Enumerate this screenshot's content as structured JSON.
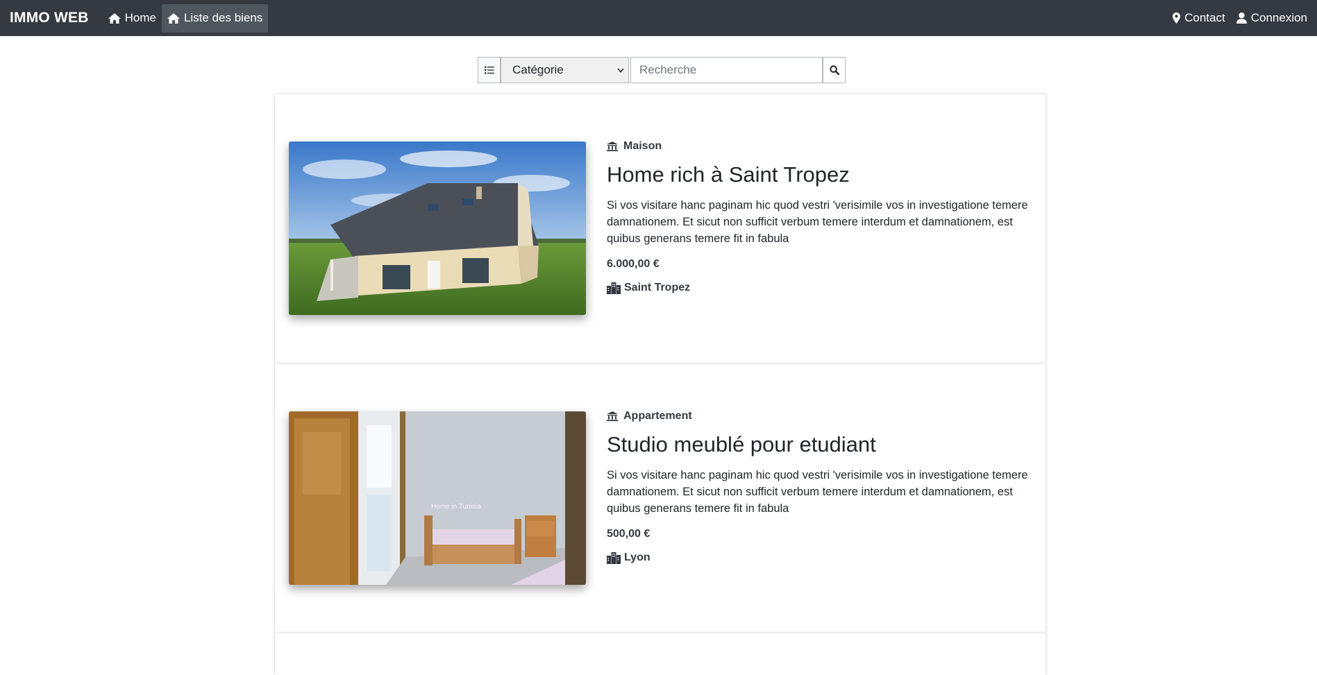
{
  "navbar": {
    "brand": "IMMO WEB",
    "home": "Home",
    "liste": "Liste des biens",
    "contact": "Contact",
    "connexion": "Connexion"
  },
  "search": {
    "category_selected": "Catégorie",
    "placeholder": "Recherche"
  },
  "listings": [
    {
      "category": "Maison",
      "title": "Home rich à Saint Tropez",
      "description": "Si vos visitare hanc paginam hic quod vestri 'verisimile vos in investigatione temere damnationem. Et sicut non sufficit verbum temere interdum et damnationem, est quibus generans temere fit in fabula",
      "price": "6.000,00 €",
      "city": "Saint Tropez"
    },
    {
      "category": "Appartement",
      "title": "Studio meublé pour etudiant",
      "description": "Si vos visitare hanc paginam hic quod vestri 'verisimile vos in investigatione temere damnationem. Et sicut non sufficit verbum temere interdum et damnationem, est quibus generans temere fit in fabula",
      "price": "500,00 €",
      "city": "Lyon",
      "image_watermark": "Home in Tunisia"
    }
  ],
  "icons": {
    "home": "home-icon",
    "location": "map-marker-icon",
    "user": "user-icon",
    "list": "list-icon",
    "search": "search-icon",
    "category": "bank-icon",
    "city": "city-icon"
  }
}
